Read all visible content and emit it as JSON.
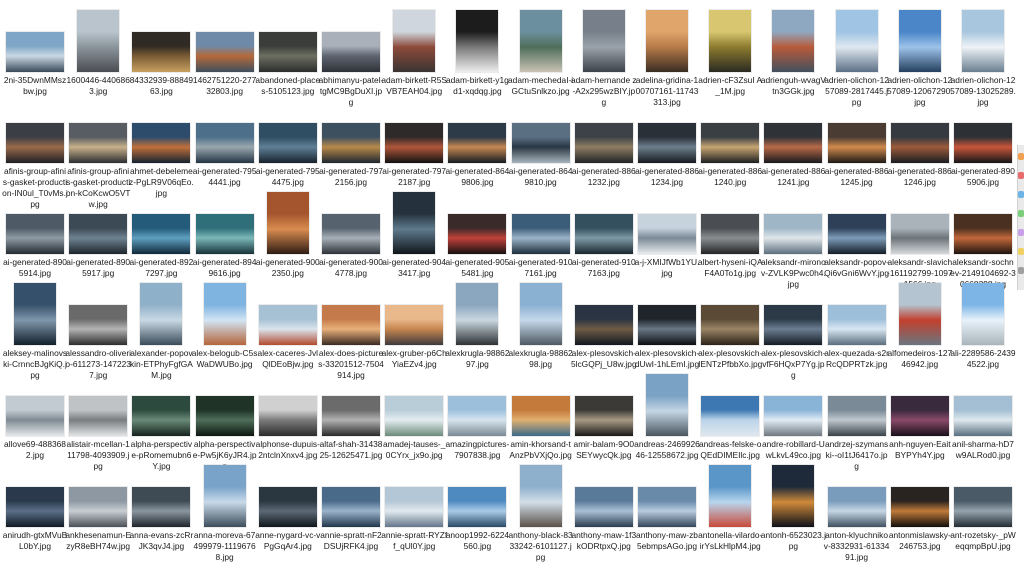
{
  "items": [
    {
      "name": "2ni-35DwnMMszbw.jpg",
      "shape": "l",
      "colors": [
        "#7fa6c6",
        "#c9d7e3",
        "#3b4a58"
      ]
    },
    {
      "name": "1600446-4406863.jpg",
      "shape": "p",
      "colors": [
        "#b9c4cc",
        "#8a949b",
        "#4b4d52"
      ]
    },
    {
      "name": "84332939-8884963.jpg",
      "shape": "l",
      "colors": [
        "#2f2a24",
        "#7a5b34",
        "#c7a060"
      ]
    },
    {
      "name": "1462751220-27732803.jpg",
      "shape": "l",
      "colors": [
        "#6e8aa8",
        "#b5693a",
        "#3e4f5e"
      ]
    },
    {
      "name": "abandoned-places-5105123.jpg",
      "shape": "l",
      "colors": [
        "#3a3d3a",
        "#6c6f62",
        "#2b2d2c"
      ]
    },
    {
      "name": "abhimanyu-patel-tgMC9BgDuXI.jpg",
      "shape": "l",
      "colors": [
        "#a9b0ba",
        "#5d6470",
        "#2f3138"
      ]
    },
    {
      "name": "adam-birkett-R5SVB7EAH04.jpg",
      "shape": "p",
      "colors": [
        "#cfd6de",
        "#8c4a3a",
        "#3a3433"
      ]
    },
    {
      "name": "adam-birkett-y1gd1-xqdqg.jpg",
      "shape": "p",
      "colors": [
        "#1c1c1c",
        "#7a7a7a",
        "#eeeeee"
      ]
    },
    {
      "name": "adam-mechedaI-iGCtuSnlkzo.jpg",
      "shape": "p",
      "colors": [
        "#6b8f9e",
        "#4f6f5a",
        "#c9c3b5"
      ]
    },
    {
      "name": "adam-hernande z-A2x295wzBIY.jpg",
      "shape": "p",
      "colors": [
        "#77808a",
        "#9aa2ab",
        "#3c4249"
      ]
    },
    {
      "name": "adelina-gridina-100707161-11743313.jpg",
      "shape": "p",
      "colors": [
        "#e0a56b",
        "#b57a48",
        "#3b2d24"
      ]
    },
    {
      "name": "adrien-cF3ZsuI A_1M.jpg",
      "shape": "p",
      "colors": [
        "#d8c770",
        "#8c7a2f",
        "#2a2a22"
      ]
    },
    {
      "name": "adrienguh-wvagVtn3GGk.jpg",
      "shape": "p",
      "colors": [
        "#8fa8c2",
        "#b85a3a",
        "#42505e"
      ]
    },
    {
      "name": "adrien-olichon-1257089-2817445.jpg",
      "shape": "p",
      "colors": [
        "#9fc4e4",
        "#dfe8f0",
        "#5c7086"
      ]
    },
    {
      "name": "adrien-olichon-1257089-12067290.jpg",
      "shape": "p",
      "colors": [
        "#4a86c8",
        "#9dc3ea",
        "#25405f"
      ]
    },
    {
      "name": "adrien-olichon-1257089-13025289.jpg",
      "shape": "p",
      "colors": [
        "#a8c6dd",
        "#eef3f7",
        "#6a7f90"
      ]
    },
    {
      "name": "afinis-group-afinis-gasket-production-IN0ul_T0vMs.jpg",
      "shape": "l",
      "colors": [
        "#3b3e45",
        "#9a6a4a",
        "#1e2025"
      ]
    },
    {
      "name": "afinis-group-afinis-gasket-production-kCoKcwO5VTw.jpg",
      "shape": "l",
      "colors": [
        "#585c63",
        "#c7b18a",
        "#2b2d31"
      ]
    },
    {
      "name": "ahmet-debelemez-PgLR9V06qEo.jpg",
      "shape": "l",
      "colors": [
        "#2d4c6c",
        "#c0703a",
        "#142331"
      ]
    },
    {
      "name": "ai-generated-7954441.jpg",
      "shape": "l",
      "colors": [
        "#4d6f8a",
        "#9aa7ae",
        "#243444"
      ]
    },
    {
      "name": "ai-generated-7954475.jpg",
      "shape": "l",
      "colors": [
        "#2f4d63",
        "#5f7f96",
        "#17222c"
      ]
    },
    {
      "name": "ai-generated-7972156.jpg",
      "shape": "l",
      "colors": [
        "#3d5060",
        "#b8894a",
        "#1d2630"
      ]
    },
    {
      "name": "ai-generated-7972187.jpg",
      "shape": "l",
      "colors": [
        "#2e2a29",
        "#b0563a",
        "#121212"
      ]
    },
    {
      "name": "ai-generated-8649806.jpg",
      "shape": "l",
      "colors": [
        "#2d3a47",
        "#c48750",
        "#151c23"
      ]
    },
    {
      "name": "ai-generated-8649810.jpg",
      "shape": "l",
      "colors": [
        "#5a6f82",
        "#2a3744",
        "#a8b5bd"
      ]
    },
    {
      "name": "ai-generated-8861232.jpg",
      "shape": "l",
      "colors": [
        "#3d4248",
        "#8e7d62",
        "#202327"
      ]
    },
    {
      "name": "ai-generated-8861234.jpg",
      "shape": "l",
      "colors": [
        "#2a3038",
        "#6d7e8c",
        "#161a1f"
      ]
    },
    {
      "name": "ai-generated-8861240.jpg",
      "shape": "l",
      "colors": [
        "#3a3f44",
        "#c7a472",
        "#1c1f22"
      ]
    },
    {
      "name": "ai-generated-8861241.jpg",
      "shape": "l",
      "colors": [
        "#2f3338",
        "#b86a48",
        "#17191c"
      ]
    },
    {
      "name": "ai-generated-8861245.jpg",
      "shape": "l",
      "colors": [
        "#4a3c33",
        "#d08a4d",
        "#1d1916"
      ]
    },
    {
      "name": "ai-generated-8861246.jpg",
      "shape": "l",
      "colors": [
        "#343a40",
        "#9c5a3c",
        "#1a1d20"
      ]
    },
    {
      "name": "ai-generated-8905906.jpg",
      "shape": "l",
      "colors": [
        "#2d3136",
        "#c8563a",
        "#141618"
      ]
    },
    {
      "name": "ai-generated-8905914.jpg",
      "shape": "l",
      "colors": [
        "#4e5a66",
        "#8e9aa4",
        "#242a30"
      ]
    },
    {
      "name": "ai-generated-8905917.jpg",
      "shape": "l",
      "colors": [
        "#3c4a55",
        "#6f8391",
        "#1d252b"
      ]
    },
    {
      "name": "ai-generated-8927297.jpg",
      "shape": "l",
      "colors": [
        "#245a7a",
        "#5ea0c0",
        "#10283a"
      ]
    },
    {
      "name": "ai-generated-8949616.jpg",
      "shape": "l",
      "colors": [
        "#2f6f7a",
        "#7bb8b8",
        "#163238"
      ]
    },
    {
      "name": "ai-generated-9002350.jpg",
      "shape": "p",
      "colors": [
        "#a4552e",
        "#d98c4f",
        "#2e1c14"
      ]
    },
    {
      "name": "ai-generated-9004778.jpg",
      "shape": "l",
      "colors": [
        "#56626e",
        "#a7b0b8",
        "#2c3238"
      ]
    },
    {
      "name": "ai-generated-9043417.jpg",
      "shape": "p",
      "colors": [
        "#25323d",
        "#5e7a8c",
        "#0f151a"
      ]
    },
    {
      "name": "ai-generated-9055481.jpg",
      "shape": "l",
      "colors": [
        "#3b2a2a",
        "#c0423a",
        "#171111"
      ]
    },
    {
      "name": "ai-generated-9107161.jpg",
      "shape": "l",
      "colors": [
        "#3c5d7a",
        "#9bb4c8",
        "#1d2e3c"
      ]
    },
    {
      "name": "ai-generated-9107163.jpg",
      "shape": "l",
      "colors": [
        "#34505e",
        "#7e9aa6",
        "#18262e"
      ]
    },
    {
      "name": "a-j-XMIJfWb1YU.jpg",
      "shape": "l",
      "colors": [
        "#c6d2dc",
        "#7b8a96",
        "#e8ecef"
      ]
    },
    {
      "name": "albert-hyseni-iQAF4A0To1g.jpg",
      "shape": "l",
      "colors": [
        "#4a4e52",
        "#8a8e90",
        "#222426"
      ]
    },
    {
      "name": "aleksandr-mironov-ZVLK9Pwc0h4.jpg",
      "shape": "l",
      "colors": [
        "#9fb6c7",
        "#dfe6ea",
        "#5c6f7d"
      ]
    },
    {
      "name": "aleksandr-popov-Qi6vGni6WvY.jpg",
      "shape": "l",
      "colors": [
        "#2e4058",
        "#7d9cb8",
        "#141d28"
      ]
    },
    {
      "name": "aleksandr-slavich-161192799-10971566.jpg",
      "shape": "l",
      "colors": [
        "#a9b3b9",
        "#6c7479",
        "#d6dadc"
      ]
    },
    {
      "name": "aleksandr-sochnev-2149104692-30668298.jpg",
      "shape": "l",
      "colors": [
        "#4a3020",
        "#c2683a",
        "#1e140e"
      ]
    },
    {
      "name": "aleksey-malinovski-CrnncBJgKiQ.jpg",
      "shape": "p",
      "colors": [
        "#35506a",
        "#7f96ab",
        "#14202c"
      ]
    },
    {
      "name": "alessandro-oliverio-611273-1472237.jpg",
      "shape": "l",
      "colors": [
        "#6a6a6a",
        "#b4b4b4",
        "#2d2d2d"
      ]
    },
    {
      "name": "alexander-popovkin-ETPhyFgfGAM.jpg",
      "shape": "p",
      "colors": [
        "#8fb0c9",
        "#c9d9e4",
        "#3b4c5a"
      ]
    },
    {
      "name": "alex-belogub-C5sWaDWUBo.jpg",
      "shape": "p",
      "colors": [
        "#7fb3e0",
        "#d1e5f4",
        "#b5653a"
      ]
    },
    {
      "name": "alex-caceres-JvlQlDEoBjw.jpg",
      "shape": "l",
      "colors": [
        "#a6c0d4",
        "#d9e5ed",
        "#b24a2e"
      ]
    },
    {
      "name": "alex-does-pictures-33201512-7504914.jpg",
      "shape": "l",
      "colors": [
        "#c47a4a",
        "#e8b07a",
        "#3a2a22"
      ]
    },
    {
      "name": "alex-gruber-p6ChYiaEZv4.jpg",
      "shape": "l",
      "colors": [
        "#e9b98c",
        "#c6864f",
        "#3e3a3c"
      ]
    },
    {
      "name": "alexkrugla-9886297.jpg",
      "shape": "p",
      "colors": [
        "#8aa7bf",
        "#c9d6df",
        "#2e3235"
      ]
    },
    {
      "name": "alexkrugla-9886298.jpg",
      "shape": "p",
      "colors": [
        "#8ab0d2",
        "#c5d9ea",
        "#4f5a63"
      ]
    },
    {
      "name": "alex-plesovskich-5lcGQPj_U8w.jpg",
      "shape": "l",
      "colors": [
        "#2a3442",
        "#6f5c46",
        "#121820"
      ]
    },
    {
      "name": "alex-plesovskich-dUwI-1hLEmI.jpg",
      "shape": "l",
      "colors": [
        "#1f252b",
        "#6a7785",
        "#0c0f12"
      ]
    },
    {
      "name": "alex-plesovskich-IENTzPfbbXo.jpg",
      "shape": "l",
      "colors": [
        "#5a4a36",
        "#9a8465",
        "#2a2218"
      ]
    },
    {
      "name": "alex-plesovskich-vfF6HQxP7Yg.jpg",
      "shape": "l",
      "colors": [
        "#2c3a48",
        "#6b7d90",
        "#141c24"
      ]
    },
    {
      "name": "alex-quezada-s2rRcQDPRTzk.jpg",
      "shape": "l",
      "colors": [
        "#9ebfda",
        "#d8e6f1",
        "#5b6e7e"
      ]
    },
    {
      "name": "alfomedeiros-12746942.jpg",
      "shape": "p",
      "colors": [
        "#b4c4d0",
        "#c2402e",
        "#6a7680"
      ]
    },
    {
      "name": "ali-2289586-24394522.jpg",
      "shape": "p",
      "colors": [
        "#7db6e6",
        "#e8f2fa",
        "#a9b4bb"
      ]
    },
    {
      "name": "allove69-4883682.jpg",
      "shape": "l",
      "colors": [
        "#c2cad2",
        "#7f8b94",
        "#e5e9ec"
      ]
    },
    {
      "name": "alistair-mcellan-111798-4093909.jpg",
      "shape": "l",
      "colors": [
        "#bfc3c6",
        "#7a7d80",
        "#e2e4e5"
      ]
    },
    {
      "name": "alpha-perspective-pRomemubn6Y.jpg",
      "shape": "l",
      "colors": [
        "#2d4a3e",
        "#6a8a78",
        "#14221c"
      ]
    },
    {
      "name": "alpha-perspective-Pw5jK6yJR4.jpg",
      "shape": "l",
      "colors": [
        "#1f3326",
        "#4f6e5a",
        "#0c1610"
      ]
    },
    {
      "name": "alphonse-dupuis-2ntclnXnxv4.jpg",
      "shape": "l",
      "colors": [
        "#d0d0d0",
        "#7c7c7c",
        "#2c2c2c"
      ]
    },
    {
      "name": "altaf-shah-3143825-12625471.jpg",
      "shape": "l",
      "colors": [
        "#6b6b6b",
        "#b2b2b2",
        "#2a2a2a"
      ]
    },
    {
      "name": "amadej-tauses-_0CYrx_jx9o.jpg",
      "shape": "l",
      "colors": [
        "#b8cdd8",
        "#e4edf1",
        "#6c8a7a"
      ]
    },
    {
      "name": "amazingpictures-7907838.jpg",
      "shape": "l",
      "colors": [
        "#9cc0dc",
        "#d7e4ee",
        "#7a8a94"
      ]
    },
    {
      "name": "amin-khorsand-tAnzPbVXjQo.jpg",
      "shape": "l",
      "colors": [
        "#c47a3a",
        "#e0b070",
        "#3a6a8a"
      ]
    },
    {
      "name": "amir-balam-9O0SEYwycQk.jpg",
      "shape": "l",
      "colors": [
        "#3c3a36",
        "#a89a84",
        "#1a1917"
      ]
    },
    {
      "name": "andreas-246992646-12558672.jpg",
      "shape": "p",
      "colors": [
        "#7aa2c4",
        "#c4d6e4",
        "#4a5660"
      ]
    },
    {
      "name": "andreas-felske-oQEdDIMEIlc.jpg",
      "shape": "l",
      "colors": [
        "#3e78b2",
        "#bcd4ea",
        "#dfe7ee"
      ]
    },
    {
      "name": "andre-robillard-UwLkvL49co.jpg",
      "shape": "l",
      "colors": [
        "#8ab3d8",
        "#e0ebf4",
        "#6f7880"
      ]
    },
    {
      "name": "andrzej-szymanski--oI1tJ6417o.jpg",
      "shape": "l",
      "colors": [
        "#7a8a96",
        "#c0c8ce",
        "#3a424a"
      ]
    },
    {
      "name": "anh-nguyen-EaitBYPYh4Y.jpg",
      "shape": "l",
      "colors": [
        "#3a2a3e",
        "#8a4a6a",
        "#180f1a"
      ]
    },
    {
      "name": "anil-sharma-hD7w9ALRod0.jpg",
      "shape": "l",
      "colors": [
        "#a4bfd4",
        "#dfe8ee",
        "#5a6f7f"
      ]
    },
    {
      "name": "anirudh-gtxMVuBL0bY.jpg",
      "shape": "l",
      "colors": [
        "#2a3a4c",
        "#5a7088",
        "#111a24"
      ]
    },
    {
      "name": "ankhesenamun-EzyR8eBH74w.jpg",
      "shape": "l",
      "colors": [
        "#8e98a2",
        "#c9ced3",
        "#4a5057"
      ]
    },
    {
      "name": "anna-evans-zcRrJK3qvJ4.jpg",
      "shape": "l",
      "colors": [
        "#3e4a54",
        "#8a96a0",
        "#1d232a"
      ]
    },
    {
      "name": "anna-moreva-67499979-11196768.jpg",
      "shape": "p",
      "colors": [
        "#7aa3c9",
        "#c8daea",
        "#3d4c59"
      ]
    },
    {
      "name": "anne-nygard-vc-vPgGqAr4.jpg",
      "shape": "l",
      "colors": [
        "#2a3640",
        "#5c6a76",
        "#10161b"
      ]
    },
    {
      "name": "annie-spratt-nF2DSUjRFK4.jpg",
      "shape": "l",
      "colors": [
        "#4a6a8a",
        "#9ab4cc",
        "#22364a"
      ]
    },
    {
      "name": "annie-spratt-RYZff_qUl0Y.jpg",
      "shape": "l",
      "colors": [
        "#b3c7d6",
        "#e2eaf0",
        "#63758a"
      ]
    },
    {
      "name": "anoop1992-6224560.jpg",
      "shape": "l",
      "colors": [
        "#4e8ac0",
        "#a9cbe8",
        "#294a66"
      ]
    },
    {
      "name": "anthony-black-8333242-6101127.jpg",
      "shape": "p",
      "colors": [
        "#8fb0cc",
        "#d2dfe9",
        "#5a5048"
      ]
    },
    {
      "name": "anthony-maw-1f3kODRtpxQ.jpg",
      "shape": "l",
      "colors": [
        "#5a7a9a",
        "#a9c1d6",
        "#2a3c4e"
      ]
    },
    {
      "name": "anthony-maw-zb5ebmpsAGo.jpg",
      "shape": "l",
      "colors": [
        "#6a8aaa",
        "#b8cce0",
        "#34465a"
      ]
    },
    {
      "name": "antonella-vilardo-irYsLkHlpM4.jpg",
      "shape": "p",
      "colors": [
        "#5a96c8",
        "#b8d6ee",
        "#c84a3a"
      ]
    },
    {
      "name": "antonh-6523023.jpg",
      "shape": "p",
      "colors": [
        "#1e2a3a",
        "#d08a3a",
        "#0c1018"
      ]
    },
    {
      "name": "anton-klyuchnikov-8332931-6133491.jpg",
      "shape": "l",
      "colors": [
        "#7a9cbc",
        "#c6d6e4",
        "#3f5060"
      ]
    },
    {
      "name": "antonmislawsky-246753.jpg",
      "shape": "l",
      "colors": [
        "#2a2420",
        "#c07a3a",
        "#100d0b"
      ]
    },
    {
      "name": "ant-rozetsky-_pWeqqmpBpU.jpg",
      "shape": "l",
      "colors": [
        "#4a5a66",
        "#96a4ae",
        "#232b32"
      ]
    }
  ],
  "scrollbar_colors": [
    "#f0a050",
    "#e86c6c",
    "#6cb3e8",
    "#7ad07a",
    "#c9a0e8",
    "#f0d060",
    "#a0a0a0"
  ]
}
